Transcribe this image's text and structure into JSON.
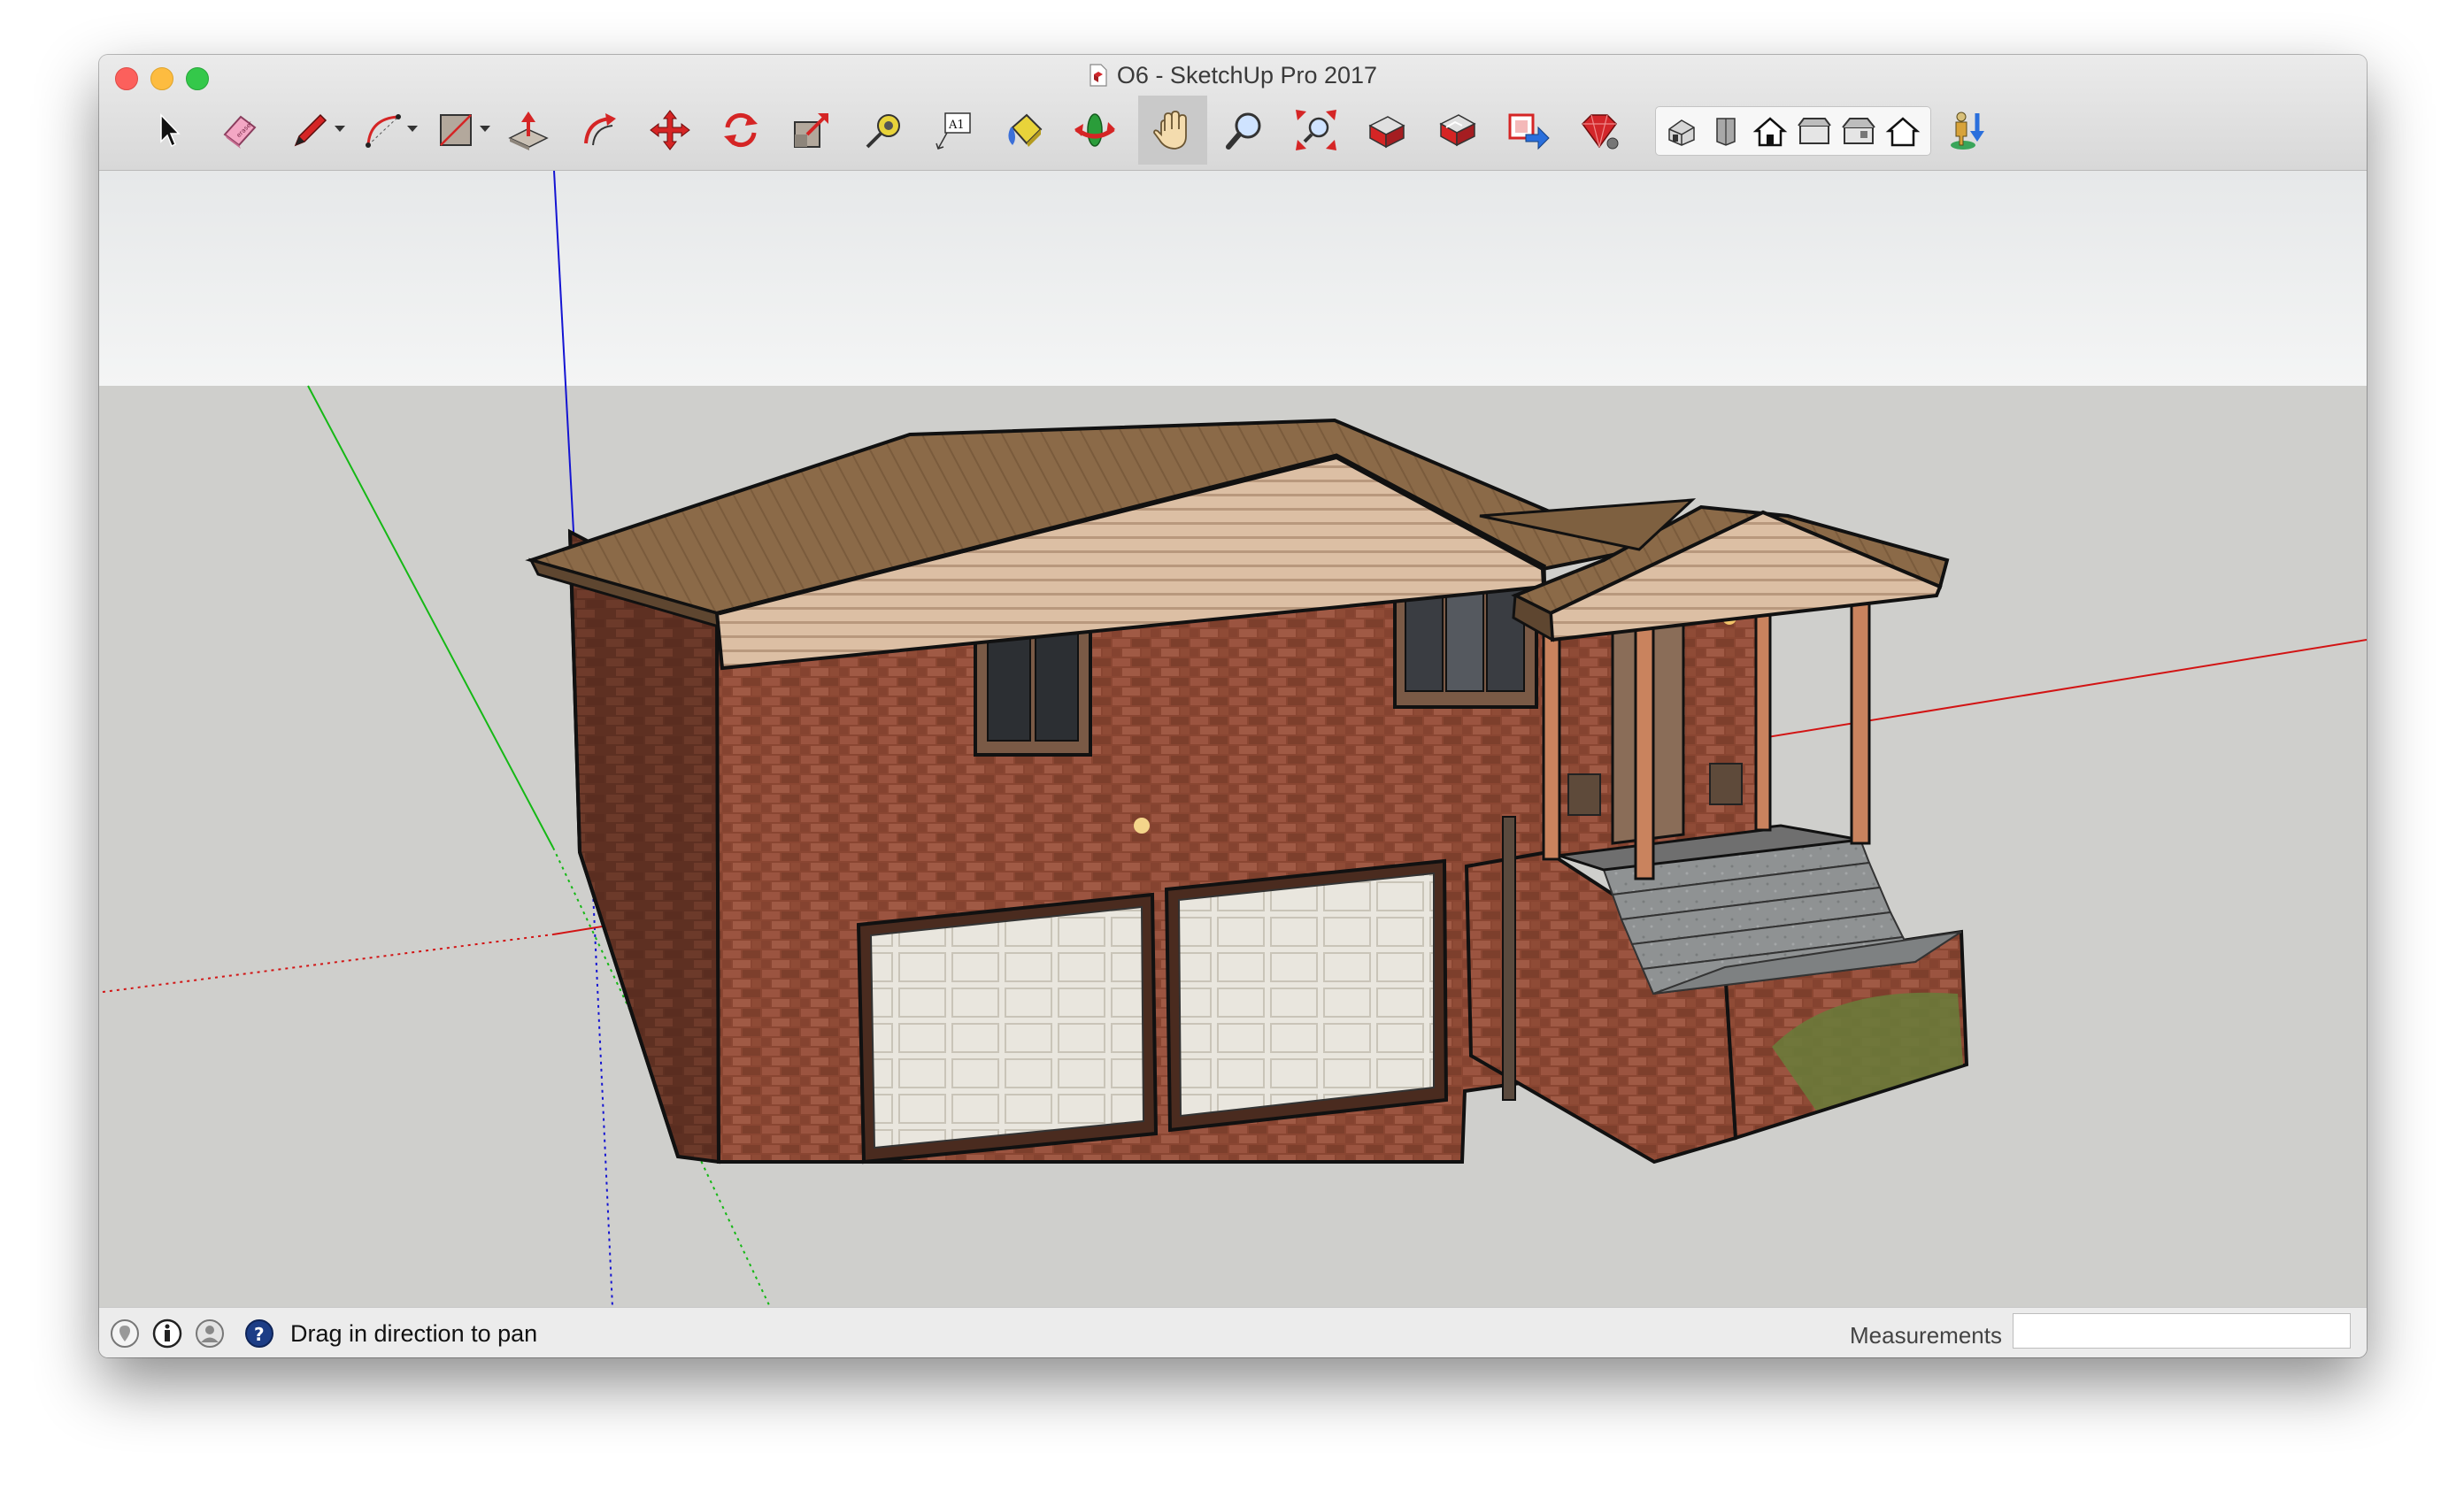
{
  "window": {
    "title": "O6 - SketchUp Pro 2017"
  },
  "toolbar": {
    "tools": [
      {
        "name": "select-tool",
        "icon": "arrow-cursor-icon"
      },
      {
        "name": "eraser-tool",
        "icon": "eraser-icon"
      },
      {
        "name": "line-tool",
        "icon": "pencil-icon",
        "dropdown": true
      },
      {
        "name": "arc-tool",
        "icon": "arc-icon",
        "dropdown": true
      },
      {
        "name": "rectangle-tool",
        "icon": "rectangle-icon",
        "dropdown": true
      },
      {
        "name": "push-pull-tool",
        "icon": "push-pull-icon"
      },
      {
        "name": "offset-tool",
        "icon": "offset-icon"
      },
      {
        "name": "move-tool",
        "icon": "move-icon"
      },
      {
        "name": "rotate-tool",
        "icon": "rotate-icon"
      },
      {
        "name": "scale-tool",
        "icon": "scale-icon"
      },
      {
        "name": "tape-measure-tool",
        "icon": "tape-measure-icon"
      },
      {
        "name": "text-tool",
        "icon": "text-icon",
        "label": "A1"
      },
      {
        "name": "paint-bucket-tool",
        "icon": "paint-bucket-icon"
      },
      {
        "name": "orbit-tool",
        "icon": "orbit-icon"
      },
      {
        "name": "pan-tool",
        "icon": "hand-icon",
        "active": true
      },
      {
        "name": "zoom-tool",
        "icon": "magnifier-icon"
      },
      {
        "name": "zoom-extents-tool",
        "icon": "zoom-extents-icon"
      },
      {
        "name": "3d-warehouse-tool",
        "icon": "warehouse-icon"
      },
      {
        "name": "extension-warehouse-tool",
        "icon": "extension-warehouse-icon"
      },
      {
        "name": "send-to-layout-tool",
        "icon": "layout-icon"
      },
      {
        "name": "extension-manager-tool",
        "icon": "ruby-icon"
      }
    ],
    "views": [
      {
        "name": "iso-view",
        "icon": "iso-house-icon"
      },
      {
        "name": "top-view",
        "icon": "top-view-icon"
      },
      {
        "name": "front-view",
        "icon": "front-view-icon"
      },
      {
        "name": "right-view",
        "icon": "right-view-icon"
      },
      {
        "name": "back-view",
        "icon": "back-view-icon"
      },
      {
        "name": "left-view",
        "icon": "left-view-icon"
      }
    ],
    "extra": {
      "name": "geo-location-tool",
      "icon": "add-location-icon"
    }
  },
  "colors": {
    "sky_top": "#e9ebec",
    "sky_bottom": "#f3f4f4",
    "ground": "#cfcfcc",
    "axis_red": "#d21414",
    "axis_green": "#15b815",
    "axis_blue": "#1414d2",
    "brick": "#8e4a34",
    "roof": "#8b6a48",
    "siding": "#dcbfa4"
  },
  "status": {
    "icons": [
      "geolocation-icon",
      "credits-icon",
      "account-icon",
      "help-icon"
    ],
    "text": "Drag in direction to pan",
    "measurements_label": "Measurements",
    "measurements_value": ""
  }
}
